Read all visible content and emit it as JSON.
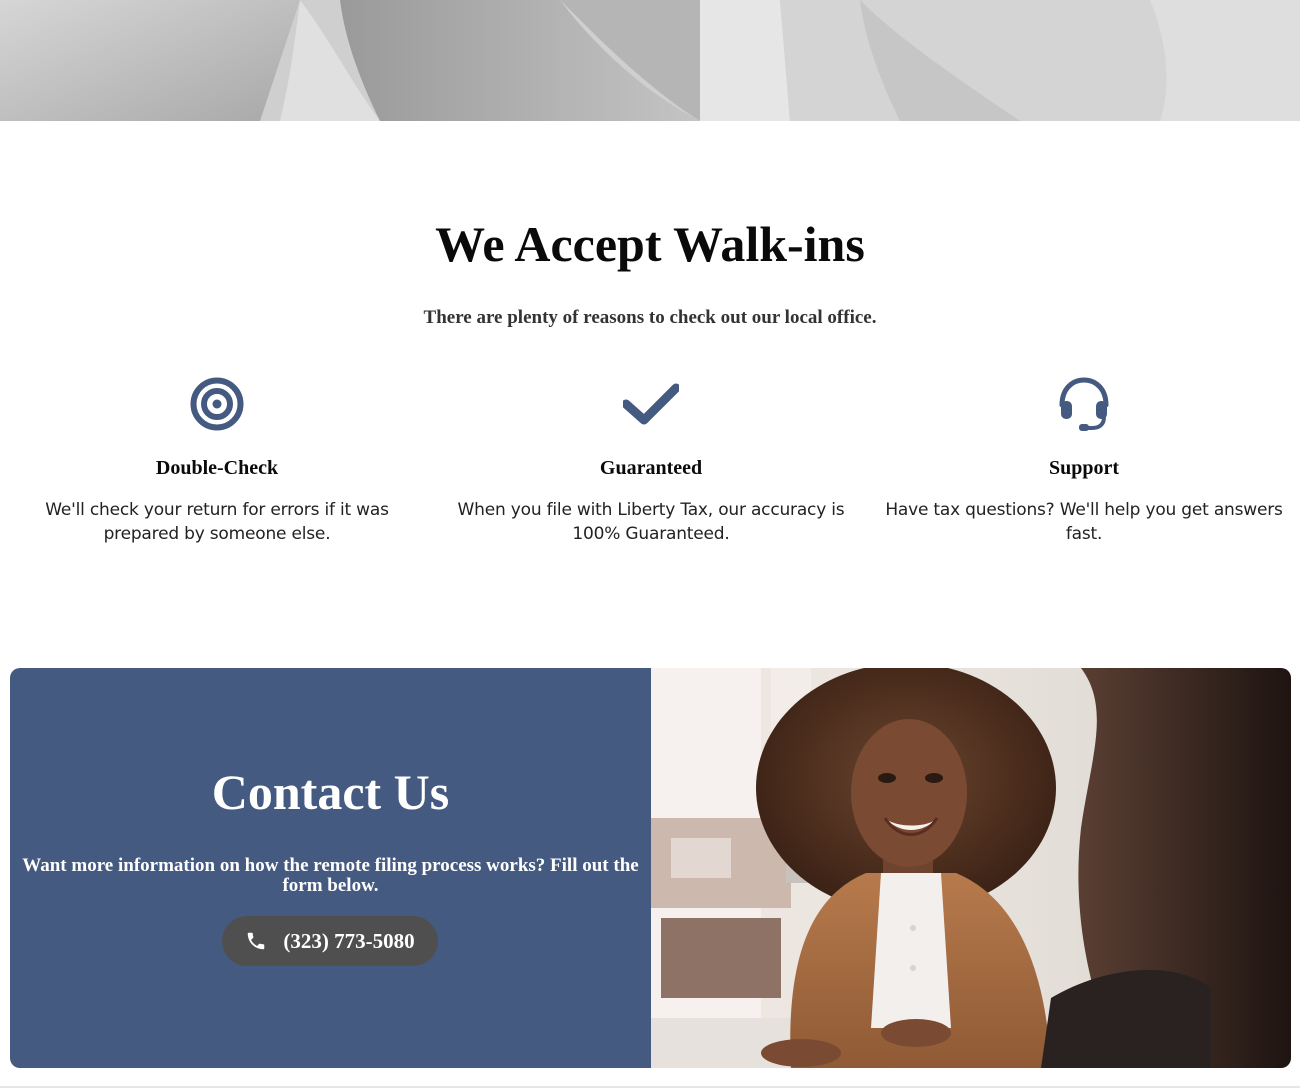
{
  "walkins": {
    "title": "We Accept Walk-ins",
    "subtitle": "There are plenty of reasons to check out our local office."
  },
  "features": [
    {
      "icon": "target-icon",
      "title": "Double-Check",
      "text": "We'll check your return for errors if it was prepared by someone else."
    },
    {
      "icon": "checkmark-icon",
      "title": "Guaranteed",
      "text": "When you file with Liberty Tax, our accuracy is 100% Guaranteed."
    },
    {
      "icon": "headset-icon",
      "title": "Support",
      "text": "Have tax questions? We'll help you get answers fast."
    }
  ],
  "contact": {
    "title": "Contact Us",
    "text": "Want more information on how the remote filing process works? Fill out the form below.",
    "phone": "(323) 773-5080",
    "phone_icon": "phone-icon"
  },
  "colors": {
    "brand_blue": "#455a80",
    "button_gray": "#4f4f50",
    "icon_blue": "#455a80"
  }
}
